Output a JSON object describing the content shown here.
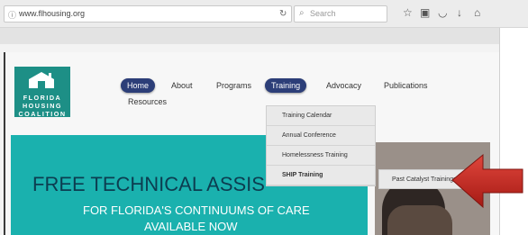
{
  "browser": {
    "url": "www.flhousing.org",
    "search_placeholder": "Search"
  },
  "logo": {
    "lines": [
      "FLORIDA",
      "HOUSING",
      "COALITION"
    ]
  },
  "nav": {
    "items": [
      "Home",
      "About",
      "Programs",
      "Training",
      "Advocacy",
      "Publications",
      "Resources"
    ]
  },
  "training_menu": {
    "items": [
      "Training Calendar",
      "Annual Conference",
      "Homelessness Training",
      "SHIP Training"
    ]
  },
  "submenu": {
    "item": "Past Catalyst Trainings"
  },
  "banner": {
    "title": "FREE TECHNICAL ASSIS",
    "subtitle1": "FOR FLORIDA'S CONTINUUMS OF CARE",
    "subtitle2": "AVAILABLE NOW"
  },
  "colors": {
    "nav_pill": "#2c3e78",
    "banner": "#1ab1ae",
    "arrow": "#c0271f",
    "logo": "#1d8f86"
  }
}
